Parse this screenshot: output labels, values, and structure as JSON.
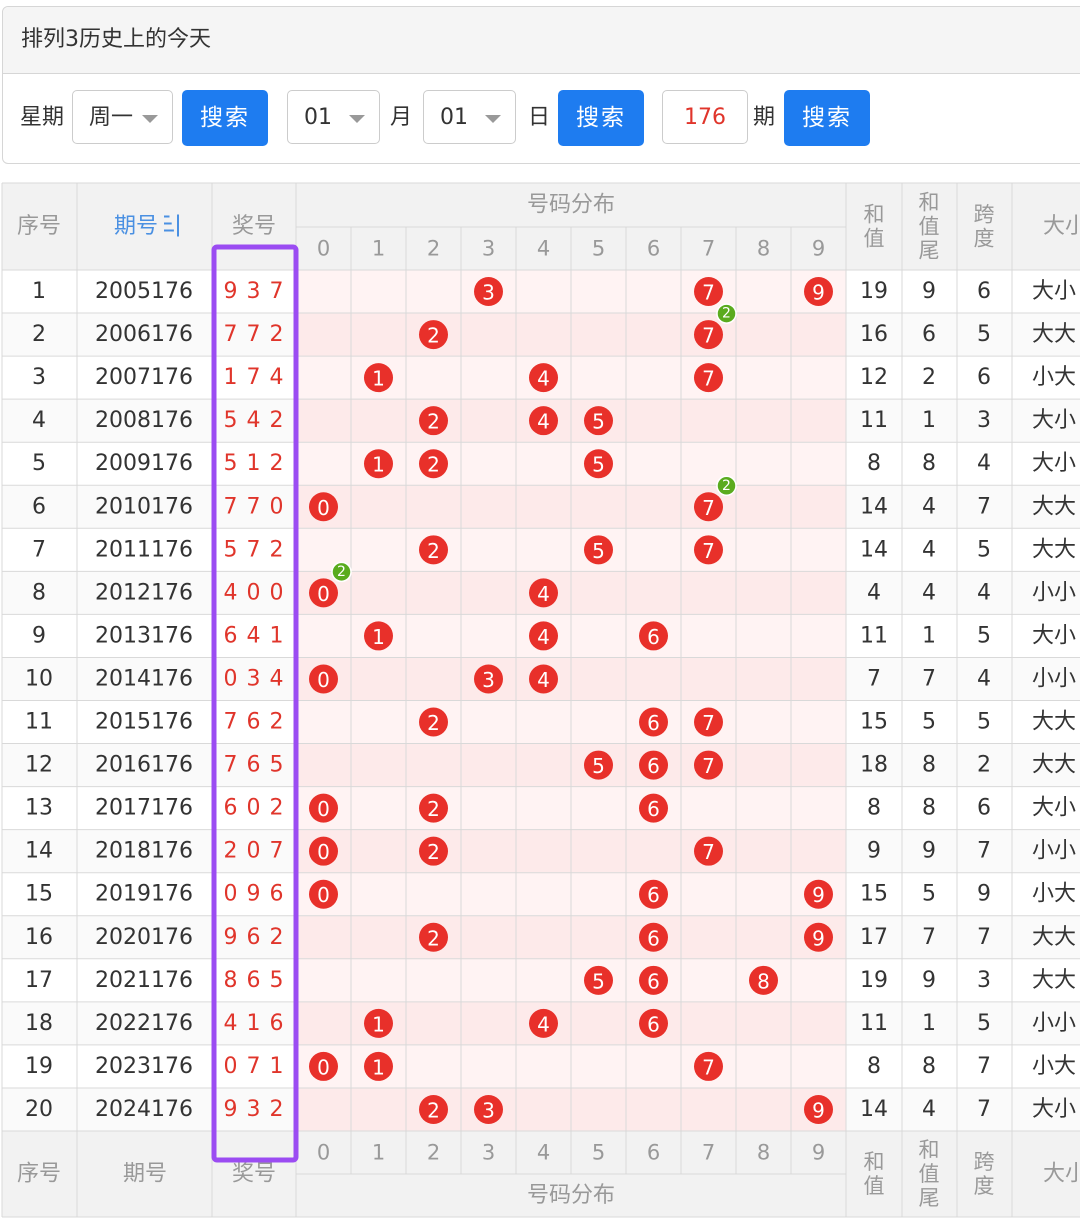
{
  "header": {
    "title": "排列3历史上的今天"
  },
  "controls": {
    "weekday_label": "星期",
    "weekday_value": "周一",
    "month_value": "01",
    "month_label": "月",
    "day_value": "01",
    "day_label": "日",
    "issue_value": "176",
    "issue_label": "期",
    "search_label": "搜索"
  },
  "table": {
    "headers": {
      "index": "序号",
      "issue": "期号",
      "prize": "奖号",
      "distribution": "号码分布",
      "sum": "和值",
      "sum_tail": "和值尾",
      "span": "跨度",
      "size": "大小"
    },
    "digits": [
      "0",
      "1",
      "2",
      "3",
      "4",
      "5",
      "6",
      "7",
      "8",
      "9"
    ],
    "rows": [
      {
        "idx": "1",
        "issue": "2005176",
        "num": "9 3 7",
        "sum": "19",
        "tail": "9",
        "span": "6",
        "size": "大小"
      },
      {
        "idx": "2",
        "issue": "2006176",
        "num": "7 7 2",
        "sum": "16",
        "tail": "6",
        "span": "5",
        "size": "大大"
      },
      {
        "idx": "3",
        "issue": "2007176",
        "num": "1 7 4",
        "sum": "12",
        "tail": "2",
        "span": "6",
        "size": "小大"
      },
      {
        "idx": "4",
        "issue": "2008176",
        "num": "5 4 2",
        "sum": "11",
        "tail": "1",
        "span": "3",
        "size": "大小"
      },
      {
        "idx": "5",
        "issue": "2009176",
        "num": "5 1 2",
        "sum": "8",
        "tail": "8",
        "span": "4",
        "size": "大小"
      },
      {
        "idx": "6",
        "issue": "2010176",
        "num": "7 7 0",
        "sum": "14",
        "tail": "4",
        "span": "7",
        "size": "大大"
      },
      {
        "idx": "7",
        "issue": "2011176",
        "num": "5 7 2",
        "sum": "14",
        "tail": "4",
        "span": "5",
        "size": "大大"
      },
      {
        "idx": "8",
        "issue": "2012176",
        "num": "4 0 0",
        "sum": "4",
        "tail": "4",
        "span": "4",
        "size": "小小"
      },
      {
        "idx": "9",
        "issue": "2013176",
        "num": "6 4 1",
        "sum": "11",
        "tail": "1",
        "span": "5",
        "size": "大小"
      },
      {
        "idx": "10",
        "issue": "2014176",
        "num": "0 3 4",
        "sum": "7",
        "tail": "7",
        "span": "4",
        "size": "小小"
      },
      {
        "idx": "11",
        "issue": "2015176",
        "num": "7 6 2",
        "sum": "15",
        "tail": "5",
        "span": "5",
        "size": "大大"
      },
      {
        "idx": "12",
        "issue": "2016176",
        "num": "7 6 5",
        "sum": "18",
        "tail": "8",
        "span": "2",
        "size": "大大"
      },
      {
        "idx": "13",
        "issue": "2017176",
        "num": "6 0 2",
        "sum": "8",
        "tail": "8",
        "span": "6",
        "size": "大小"
      },
      {
        "idx": "14",
        "issue": "2018176",
        "num": "2 0 7",
        "sum": "9",
        "tail": "9",
        "span": "7",
        "size": "小小"
      },
      {
        "idx": "15",
        "issue": "2019176",
        "num": "0 9 6",
        "sum": "15",
        "tail": "5",
        "span": "9",
        "size": "小大"
      },
      {
        "idx": "16",
        "issue": "2020176",
        "num": "9 6 2",
        "sum": "17",
        "tail": "7",
        "span": "7",
        "size": "大大"
      },
      {
        "idx": "17",
        "issue": "2021176",
        "num": "8 6 5",
        "sum": "19",
        "tail": "9",
        "span": "3",
        "size": "大大"
      },
      {
        "idx": "18",
        "issue": "2022176",
        "num": "4 1 6",
        "sum": "11",
        "tail": "1",
        "span": "5",
        "size": "小小"
      },
      {
        "idx": "19",
        "issue": "2023176",
        "num": "0 7 1",
        "sum": "8",
        "tail": "8",
        "span": "7",
        "size": "小大"
      },
      {
        "idx": "20",
        "issue": "2024176",
        "num": "9 3 2",
        "sum": "14",
        "tail": "4",
        "span": "7",
        "size": "大小"
      }
    ],
    "balls": [
      [
        {
          "d": 3
        },
        {
          "d": 7
        },
        {
          "d": 9
        }
      ],
      [
        {
          "d": 2
        },
        {
          "d": 7,
          "repeat": "2"
        }
      ],
      [
        {
          "d": 1
        },
        {
          "d": 4
        },
        {
          "d": 7
        }
      ],
      [
        {
          "d": 2
        },
        {
          "d": 4
        },
        {
          "d": 5
        }
      ],
      [
        {
          "d": 1
        },
        {
          "d": 2
        },
        {
          "d": 5
        }
      ],
      [
        {
          "d": 0
        },
        {
          "d": 7,
          "repeat": "2"
        }
      ],
      [
        {
          "d": 2
        },
        {
          "d": 5
        },
        {
          "d": 7
        }
      ],
      [
        {
          "d": 0,
          "repeat": "2"
        },
        {
          "d": 4
        }
      ],
      [
        {
          "d": 1
        },
        {
          "d": 4
        },
        {
          "d": 6
        }
      ],
      [
        {
          "d": 0
        },
        {
          "d": 3
        },
        {
          "d": 4
        }
      ],
      [
        {
          "d": 2
        },
        {
          "d": 6
        },
        {
          "d": 7
        }
      ],
      [
        {
          "d": 5
        },
        {
          "d": 6
        },
        {
          "d": 7
        }
      ],
      [
        {
          "d": 0
        },
        {
          "d": 2
        },
        {
          "d": 6
        }
      ],
      [
        {
          "d": 0
        },
        {
          "d": 2
        },
        {
          "d": 7
        }
      ],
      [
        {
          "d": 0
        },
        {
          "d": 6
        },
        {
          "d": 9
        }
      ],
      [
        {
          "d": 2
        },
        {
          "d": 6
        },
        {
          "d": 9
        }
      ],
      [
        {
          "d": 5
        },
        {
          "d": 6
        },
        {
          "d": 8
        }
      ],
      [
        {
          "d": 1
        },
        {
          "d": 4
        },
        {
          "d": 6
        }
      ],
      [
        {
          "d": 0
        },
        {
          "d": 1
        },
        {
          "d": 7
        }
      ],
      [
        {
          "d": 2
        },
        {
          "d": 3
        },
        {
          "d": 9
        }
      ]
    ]
  },
  "colors": {
    "ball": "#e8302a",
    "repeat_badge": "#5aab1e",
    "highlight": "#9b4cf2",
    "link": "#4a90e2"
  }
}
